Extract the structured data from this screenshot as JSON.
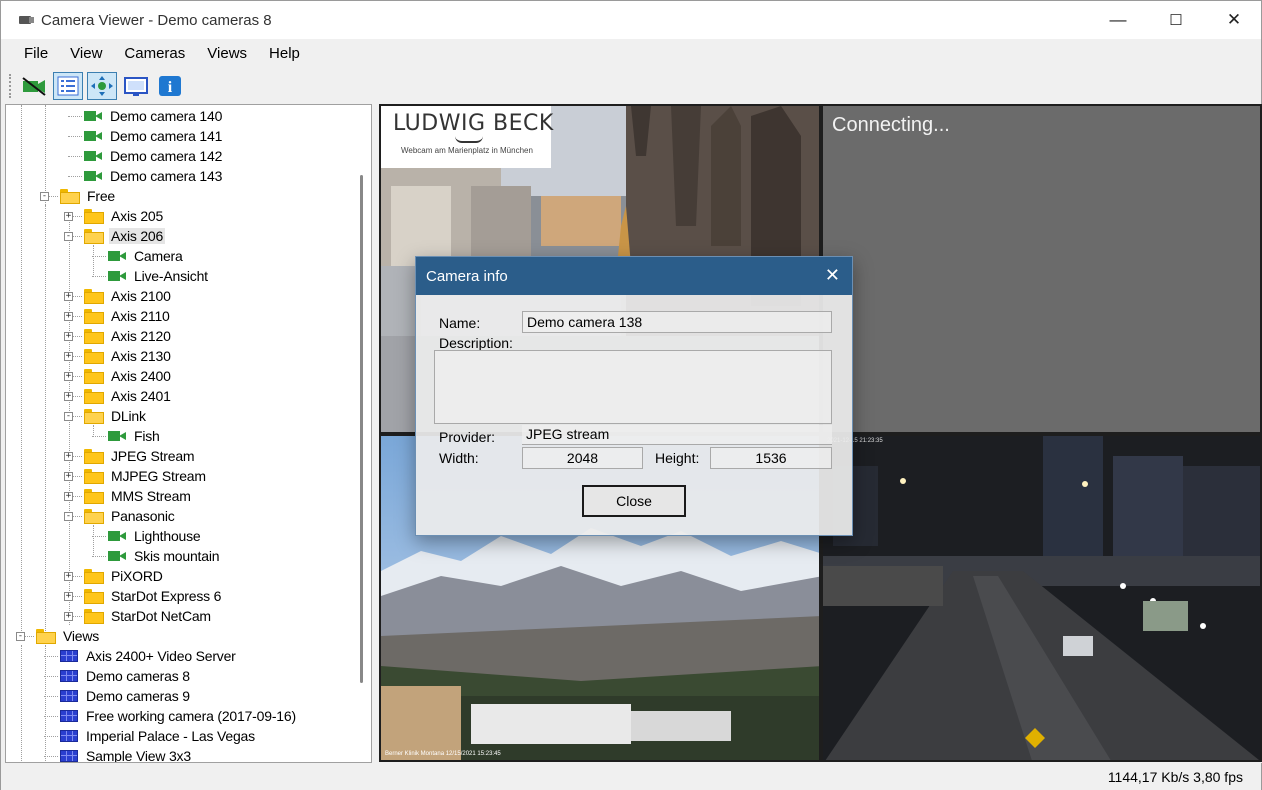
{
  "window": {
    "title": "Camera Viewer - Demo cameras 8",
    "minimize": "—",
    "maximize": "☐",
    "close": "✕"
  },
  "menu": [
    "File",
    "View",
    "Cameras",
    "Views",
    "Help"
  ],
  "toolbar": [
    {
      "name": "camera-off-icon"
    },
    {
      "name": "list-icon"
    },
    {
      "name": "fit-icon"
    },
    {
      "name": "monitor-icon"
    },
    {
      "name": "info-icon",
      "glyph": "i"
    }
  ],
  "tree": {
    "rows": [
      {
        "label": "Demo camera 140",
        "type": "camera"
      },
      {
        "label": "Demo camera 141",
        "type": "camera"
      },
      {
        "label": "Demo camera 142",
        "type": "camera"
      },
      {
        "label": "Demo camera 143",
        "type": "camera"
      },
      {
        "label": "Free",
        "type": "folder"
      },
      {
        "label": "Axis 205",
        "type": "folder"
      },
      {
        "label": "Axis 206",
        "type": "folder",
        "selected": true
      },
      {
        "label": "Camera",
        "type": "camera"
      },
      {
        "label": "Live-Ansicht",
        "type": "camera"
      },
      {
        "label": "Axis 2100",
        "type": "folder"
      },
      {
        "label": "Axis 2110",
        "type": "folder"
      },
      {
        "label": "Axis 2120",
        "type": "folder"
      },
      {
        "label": "Axis 2130",
        "type": "folder"
      },
      {
        "label": "Axis 2400",
        "type": "folder"
      },
      {
        "label": "Axis 2401",
        "type": "folder"
      },
      {
        "label": "DLink",
        "type": "folder"
      },
      {
        "label": "Fish",
        "type": "camera"
      },
      {
        "label": "JPEG Stream",
        "type": "folder"
      },
      {
        "label": "MJPEG Stream",
        "type": "folder"
      },
      {
        "label": "MMS Stream",
        "type": "folder"
      },
      {
        "label": "Panasonic",
        "type": "folder"
      },
      {
        "label": "Lighthouse",
        "type": "camera"
      },
      {
        "label": "Skis mountain",
        "type": "camera"
      },
      {
        "label": "PiXORD",
        "type": "folder"
      },
      {
        "label": "StarDot Express 6",
        "type": "folder"
      },
      {
        "label": "StarDot NetCam",
        "type": "folder"
      },
      {
        "label": "Views",
        "type": "folder"
      },
      {
        "label": "Axis 2400+ Video Server",
        "type": "view"
      },
      {
        "label": "Demo cameras 8",
        "type": "view"
      },
      {
        "label": "Demo cameras 9",
        "type": "view"
      },
      {
        "label": "Free working camera (2017-09-16)",
        "type": "view"
      },
      {
        "label": "Imperial Palace - Las Vegas",
        "type": "view"
      },
      {
        "label": "Sample View 3x3",
        "type": "view"
      }
    ]
  },
  "tiles": {
    "tl": {
      "brand": "LUDWIG BECK",
      "sub": "Webcam am Marienplatz in München"
    },
    "tr": {
      "status": "Connecting..."
    },
    "bl": {
      "caption": "Berner Klinik Montana 12/15/2021 15:23:45"
    },
    "br": {
      "caption": "2021-12-15 21:23:35"
    }
  },
  "dialog": {
    "title": "Camera info",
    "name_label": "Name:",
    "name_value": "Demo camera 138",
    "description_label": "Description:",
    "description_value": "",
    "provider_label": "Provider:",
    "provider_value": "JPEG stream",
    "width_label": "Width:",
    "width_value": "2048",
    "height_label": "Height:",
    "height_value": "1536",
    "close_button": "Close"
  },
  "status": {
    "text": "1144,17 Kb/s  3,80 fps"
  }
}
